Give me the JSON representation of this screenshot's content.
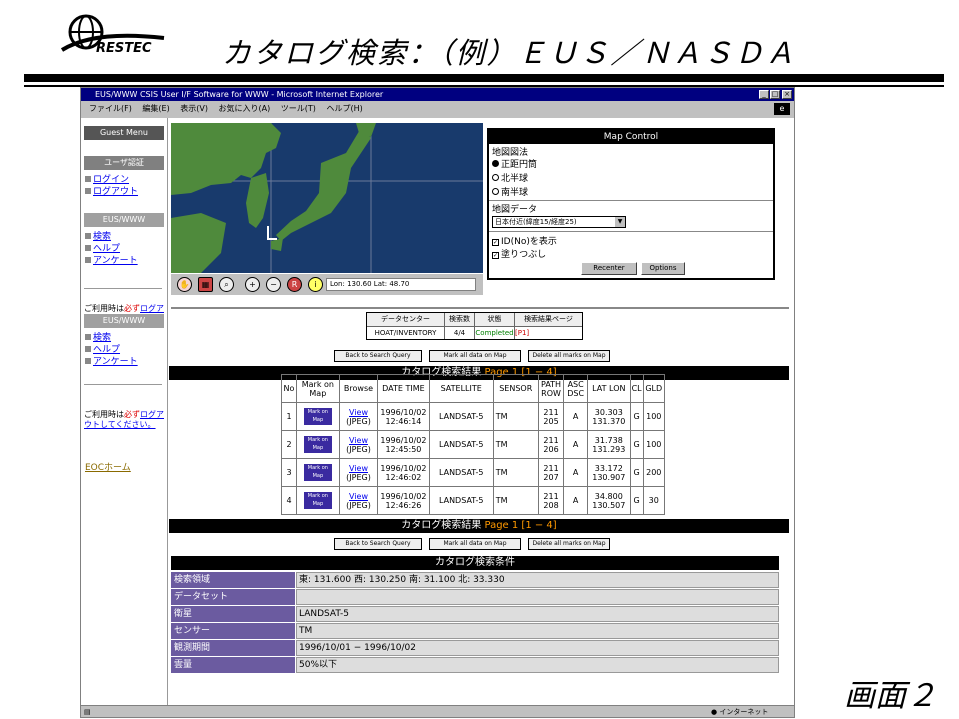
{
  "slide": {
    "logo_text": "RESTEC",
    "title": "カタログ検索：（例）ＥＵＳ／ＮＡＳＤＡ",
    "screen_label": "画面２"
  },
  "window": {
    "title": "EUS/WWW CSIS User I/F Software for WWW - Microsoft Internet Explorer",
    "menu": [
      "ファイル(F)",
      "編集(E)",
      "表示(V)",
      "お気に入り(A)",
      "ツール(T)",
      "ヘルプ(H)"
    ],
    "status_right": "インターネット"
  },
  "nav": {
    "guest_menu": "Guest Menu",
    "user_auth": "ユーザ認証",
    "login": "ログイン",
    "logout": "ログアウト",
    "eus_www": "EUS/WWW",
    "search": "検索",
    "help": "ヘルプ",
    "survey": "アンケート",
    "note1_a": "ご利用時は",
    "note1_red": "必ず",
    "note1_b": "ログアウトしてください",
    "eus_www2": "EUS/WWW",
    "search2": "検索",
    "help2": "ヘルプ",
    "survey2": "アンケート",
    "note2_a": "ご利用時は",
    "note2_red": "必ず",
    "note2_b": "ログアウトしてください。",
    "eoc_home": "EOCホーム"
  },
  "map": {
    "coords": "Lon: 130.60  Lat: 48.70",
    "tools": [
      "hand-icon",
      "globe-icon",
      "magnifier-icon",
      "zoom-in-icon",
      "zoom-out-icon",
      "reset-icon",
      "info-icon"
    ]
  },
  "map_control": {
    "title": "Map Control",
    "projection_label": "地図図法",
    "projections": [
      "正距円筒",
      "北半球",
      "南半球"
    ],
    "map_data_label": "地図データ",
    "map_data_selected": "日本付近(緯度15/経度25)",
    "show_id": "ID(No)を表示",
    "fill": "塗りつぶし",
    "recenter": "Recenter",
    "options": "Options"
  },
  "summary": {
    "headers": [
      "データセンター",
      "検索数",
      "状態",
      "検索結果ページ"
    ],
    "center": "HOAT/INVENTORY",
    "count": "4/4",
    "status": "Completed",
    "page": "[P1]"
  },
  "buttons": {
    "back": "Back to Search Query",
    "mark_all": "Mark all data on Map",
    "delete_all": "Delete all marks on Map"
  },
  "results": {
    "bar_label": "カタログ検索結果 ",
    "bar_page": "Page 1 [1 − 4]",
    "headers": [
      "No",
      "Mark on Map",
      "Browse",
      "DATE TIME",
      "SATELLITE",
      "SENSOR",
      "PATH ROW",
      "ASC DSC",
      "LAT LON",
      "CL",
      "GLD"
    ],
    "rows": [
      {
        "no": "1",
        "date": "1996/10/02",
        "time": "12:46:14",
        "sat": "LANDSAT-5",
        "sensor": "TM",
        "path": "211",
        "row": "205",
        "asc": "A",
        "lat": "30.303",
        "lon": "131.370",
        "cl": "G",
        "gld": "100"
      },
      {
        "no": "2",
        "date": "1996/10/02",
        "time": "12:45:50",
        "sat": "LANDSAT-5",
        "sensor": "TM",
        "path": "211",
        "row": "206",
        "asc": "A",
        "lat": "31.738",
        "lon": "131.293",
        "cl": "G",
        "gld": "100"
      },
      {
        "no": "3",
        "date": "1996/10/02",
        "time": "12:46:02",
        "sat": "LANDSAT-5",
        "sensor": "TM",
        "path": "211",
        "row": "207",
        "asc": "A",
        "lat": "33.172",
        "lon": "130.907",
        "cl": "G",
        "gld": "200"
      },
      {
        "no": "4",
        "date": "1996/10/02",
        "time": "12:46:26",
        "sat": "LANDSAT-5",
        "sensor": "TM",
        "path": "211",
        "row": "208",
        "asc": "A",
        "lat": "34.800",
        "lon": "130.507",
        "cl": "G",
        "gld": "30"
      }
    ],
    "mark_label": "Mark on Map",
    "view": "View",
    "view_fmt": "(JPEG)"
  },
  "conditions": {
    "title": "カタログ検索条件",
    "rows": [
      {
        "k": "検索領域",
        "v": "東: 131.600  西: 130.250  南: 31.100  北: 33.330"
      },
      {
        "k": "データセット",
        "v": ""
      },
      {
        "k": "衛星",
        "v": "LANDSAT-5"
      },
      {
        "k": "センサー",
        "v": "TM"
      },
      {
        "k": "観測期間",
        "v": "1996/10/01 − 1996/10/02"
      },
      {
        "k": "雲量",
        "v": "50%以下"
      }
    ]
  },
  "colors": {
    "titlebar": "#000080",
    "map_sea": "#183a6c",
    "map_land": "#4f8a3c",
    "cond_key": "#6b5ba0",
    "page_accent": "#ff9900"
  }
}
